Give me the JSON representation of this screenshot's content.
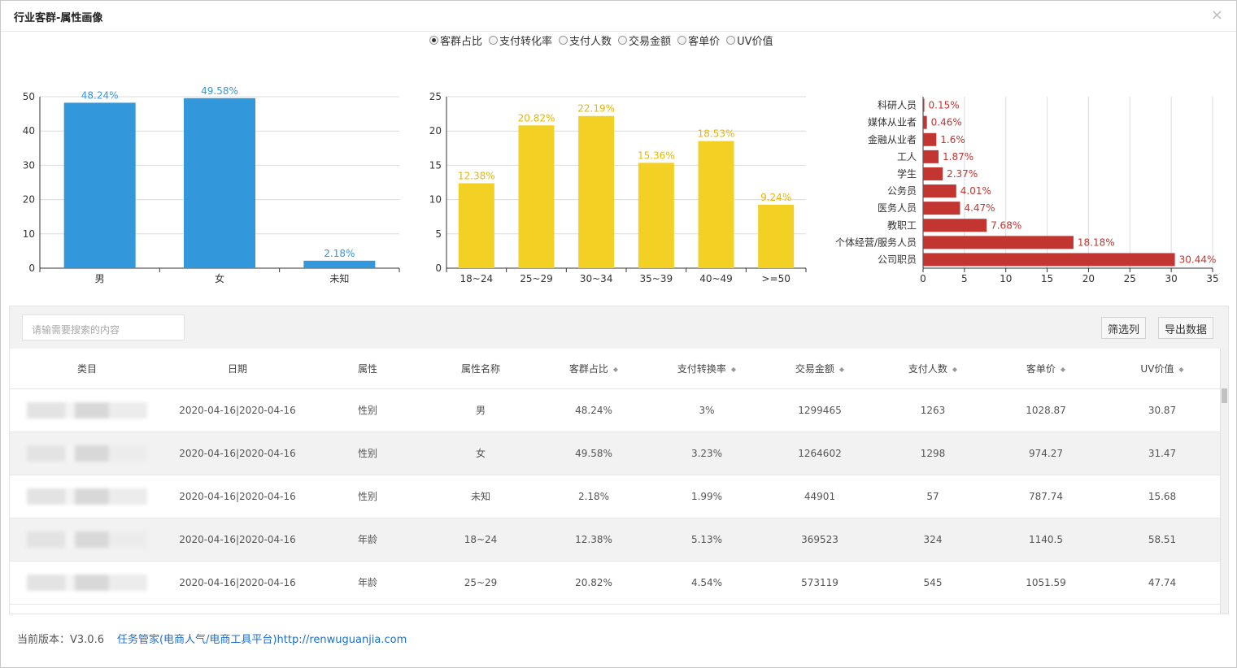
{
  "title": "行业客群-属性画像",
  "close_glyph": "×",
  "metrics": [
    {
      "label": "客群占比",
      "checked": true
    },
    {
      "label": "支付转化率",
      "checked": false
    },
    {
      "label": "支付人数",
      "checked": false
    },
    {
      "label": "交易金额",
      "checked": false
    },
    {
      "label": "客单价",
      "checked": false
    },
    {
      "label": "UV价值",
      "checked": false
    }
  ],
  "chart_data": [
    {
      "type": "bar",
      "categories": [
        "男",
        "女",
        "未知"
      ],
      "values": [
        48.24,
        49.58,
        2.18
      ],
      "value_labels": [
        "48.24%",
        "49.58%",
        "2.18%"
      ],
      "ylim": [
        0,
        50
      ],
      "yticks": [
        "0",
        "10",
        "20",
        "30",
        "40",
        "50"
      ],
      "color": "#3398db",
      "grid": true
    },
    {
      "type": "bar",
      "categories": [
        "18~24",
        "25~29",
        "30~34",
        "35~39",
        "40~49",
        ">=50"
      ],
      "values": [
        12.38,
        20.82,
        22.19,
        15.36,
        18.53,
        9.24
      ],
      "value_labels": [
        "12.38%",
        "20.82%",
        "22.19%",
        "15.36%",
        "18.53%",
        "9.24%"
      ],
      "ylim": [
        0,
        25
      ],
      "yticks": [
        "0",
        "5",
        "10",
        "15",
        "20",
        "25"
      ],
      "color": "#f2d024",
      "grid": true
    },
    {
      "type": "bar",
      "orientation": "horizontal",
      "categories": [
        "公司职员",
        "个体经营/服务人员",
        "教职工",
        "医务人员",
        "公务员",
        "学生",
        "工人",
        "金融从业者",
        "媒体从业者",
        "科研人员"
      ],
      "values": [
        30.44,
        18.18,
        7.68,
        4.47,
        4.01,
        2.37,
        1.87,
        1.6,
        0.46,
        0.15
      ],
      "value_labels": [
        "30.44%",
        "18.18%",
        "7.68%",
        "4.47%",
        "4.01%",
        "2.37%",
        "1.87%",
        "1.6%",
        "0.46%",
        "0.15%"
      ],
      "xlim": [
        0,
        35
      ],
      "xticks": [
        "0",
        "5",
        "10",
        "15",
        "20",
        "25",
        "30",
        "35"
      ],
      "color": "#c23531",
      "grid": true
    }
  ],
  "search": {
    "placeholder": "请输需要搜索的内容"
  },
  "buttons": {
    "filter_columns": "筛选列",
    "export": "导出数据"
  },
  "table": {
    "columns": [
      "类目",
      "日期",
      "属性",
      "属性名称",
      "客群占比",
      "支付转换率",
      "交易金额",
      "支付人数",
      "客单价",
      "UV价值"
    ],
    "sortable": [
      false,
      false,
      false,
      false,
      true,
      true,
      true,
      true,
      true,
      true
    ],
    "rows": [
      [
        "",
        "2020-04-16|2020-04-16",
        "性别",
        "男",
        "48.24%",
        "3%",
        "1299465",
        "1263",
        "1028.87",
        "30.87"
      ],
      [
        "",
        "2020-04-16|2020-04-16",
        "性别",
        "女",
        "49.58%",
        "3.23%",
        "1264602",
        "1298",
        "974.27",
        "31.47"
      ],
      [
        "",
        "2020-04-16|2020-04-16",
        "性别",
        "未知",
        "2.18%",
        "1.99%",
        "44901",
        "57",
        "787.74",
        "15.68"
      ],
      [
        "",
        "2020-04-16|2020-04-16",
        "年龄",
        "18~24",
        "12.38%",
        "5.13%",
        "369523",
        "324",
        "1140.5",
        "58.51"
      ],
      [
        "",
        "2020-04-16|2020-04-16",
        "年龄",
        "25~29",
        "20.82%",
        "4.54%",
        "573119",
        "545",
        "1051.59",
        "47.74"
      ]
    ]
  },
  "footer": {
    "version": "当前版本：V3.0.6",
    "link": "任务管家(电商人气/电商工具平台)http://renwuguanjia.com"
  }
}
